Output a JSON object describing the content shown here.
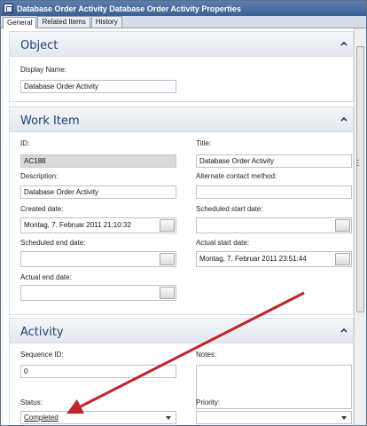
{
  "window": {
    "title": "Database Order Activity Database Order Activity Properties"
  },
  "tabs": [
    {
      "label": "General",
      "active": true
    },
    {
      "label": "Related Items",
      "active": false
    },
    {
      "label": "History",
      "active": false
    }
  ],
  "object_section": {
    "title": "Object",
    "display_name_label": "Display Name:",
    "display_name_value": "Database Order Activity"
  },
  "work_item_section": {
    "title": "Work Item",
    "id_label": "ID:",
    "id_value": "AC188",
    "title_label": "Title:",
    "title_value": "Database Order Activity",
    "description_label": "Description:",
    "description_value": "Database Order Activity",
    "alternate_contact_label": "Alternate contact method:",
    "alternate_contact_value": "",
    "created_date_label": "Created date:",
    "created_date_value": "Montag, 7. Februar 2011 21:10:32",
    "scheduled_start_label": "Scheduled start date:",
    "scheduled_start_value": "",
    "scheduled_end_label": "Scheduled end date:",
    "scheduled_end_value": "",
    "actual_start_label": "Actual start date:",
    "actual_start_value": "Montag, 7. Februar 2011 23:51:44",
    "actual_end_label": "Actual end date:",
    "actual_end_value": ""
  },
  "activity_section": {
    "title": "Activity",
    "sequence_id_label": "Sequence ID:",
    "sequence_id_value": "0",
    "notes_label": "Notes:",
    "status_label": "Status:",
    "status_value": "Completed",
    "priority_label": "Priority:",
    "priority_value": ""
  },
  "colors": {
    "title_bar": "#3a5f93",
    "section_title": "#1f3f74",
    "annotation_arrow": "#c0242b"
  }
}
